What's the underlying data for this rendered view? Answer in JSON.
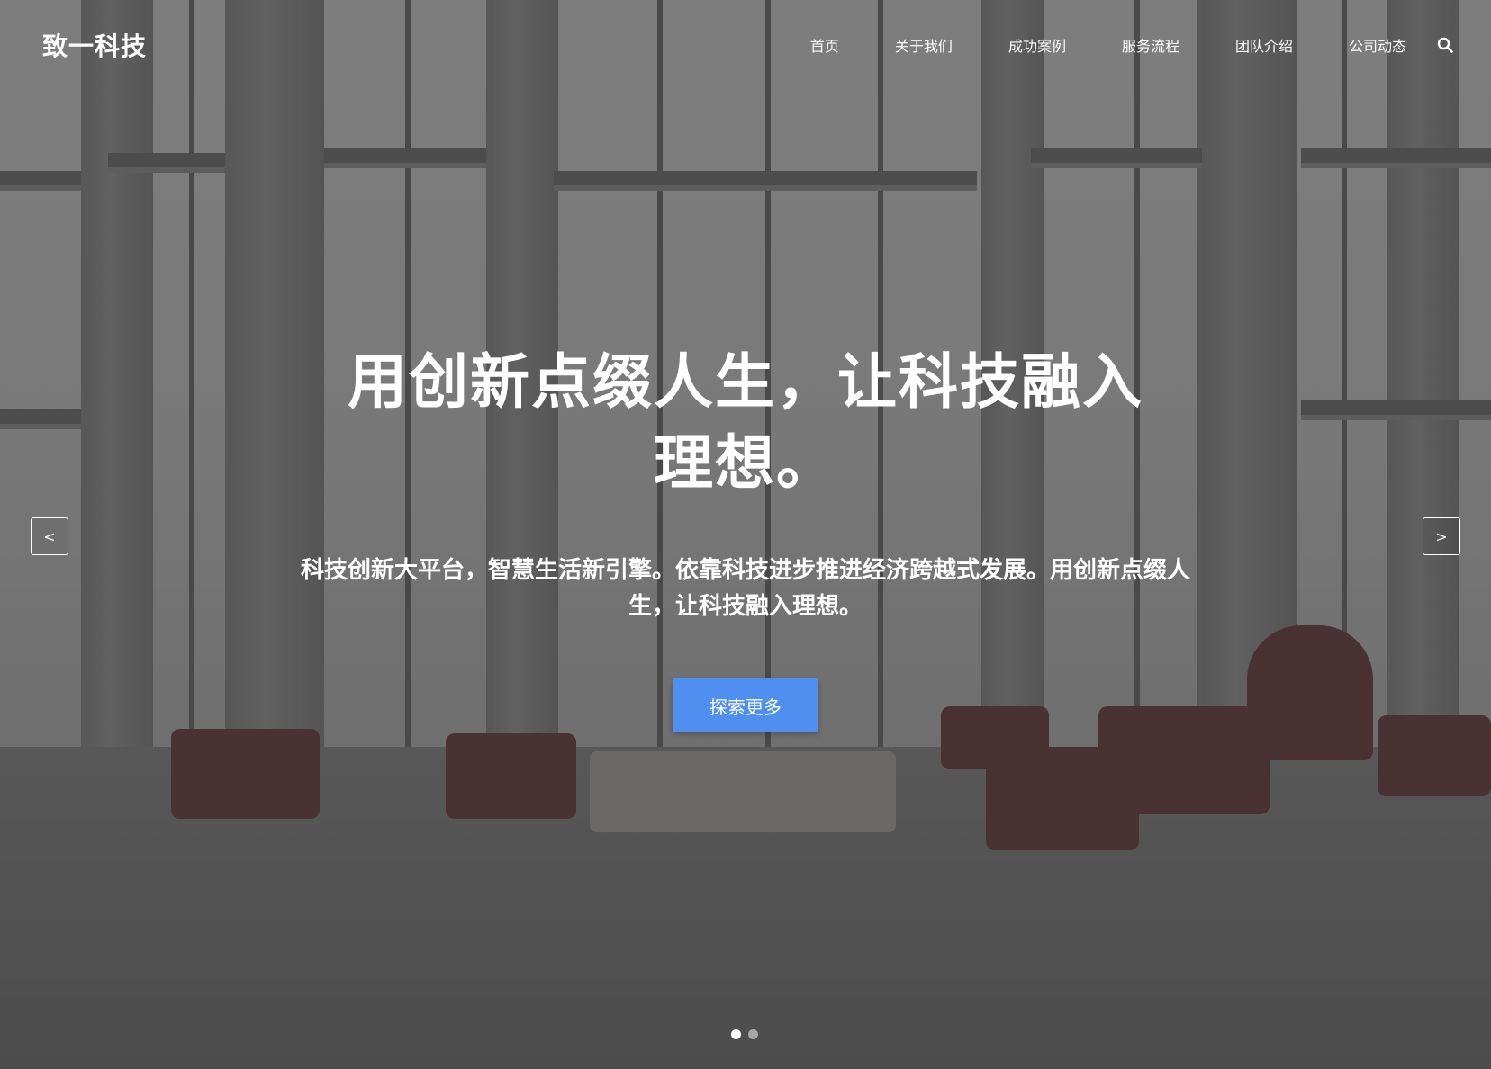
{
  "header": {
    "logo": "致一科技",
    "nav": [
      {
        "label": "首页"
      },
      {
        "label": "关于我们"
      },
      {
        "label": "成功案例"
      },
      {
        "label": "服务流程"
      },
      {
        "label": "团队介绍"
      },
      {
        "label": "公司动态"
      }
    ],
    "search_icon": "search-icon"
  },
  "hero": {
    "title": "用创新点缀人生，让科技融入理想。",
    "subtitle": "科技创新大平台，智慧生活新引擎。依靠科技进步推进经济跨越式发展。用创新点缀人生，让科技融入理想。",
    "cta_label": "探索更多"
  },
  "carousel": {
    "prev_label": "<",
    "next_label": ">",
    "active_slide": 1,
    "total_slides": 2
  },
  "colors": {
    "accent": "#4f8ff0",
    "text": "#ffffff"
  }
}
